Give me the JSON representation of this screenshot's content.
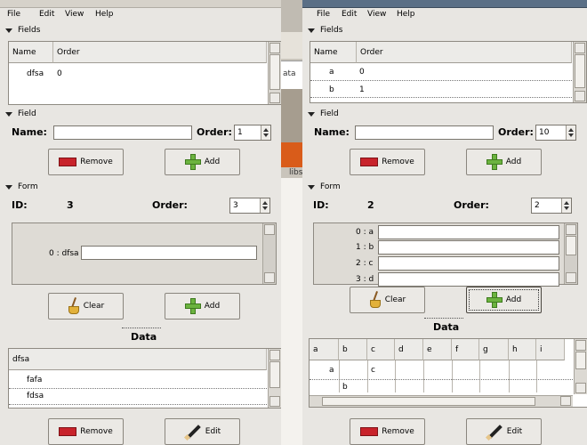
{
  "menu": [
    "File",
    "Edit",
    "View",
    "Help"
  ],
  "section_titles": {
    "fields": "Fields",
    "field": "Field",
    "form": "Form",
    "data": "Data"
  },
  "labels": {
    "name": "Name:",
    "order": "Order:",
    "id": "ID:"
  },
  "buttons": {
    "remove": "Remove",
    "add": "Add",
    "clear": "Clear",
    "edit": "Edit"
  },
  "left": {
    "fields_columns": [
      "Name",
      "Order"
    ],
    "fields_rows": [
      {
        "name": "dfsa",
        "order": "0"
      }
    ],
    "field_name_value": "",
    "field_order_value": "1",
    "form_id": "3",
    "form_order_value": "3",
    "form_entries": [
      {
        "label": "0 : dfsa",
        "value": ""
      }
    ],
    "data_columns": [
      "dfsa"
    ],
    "data_rows": [
      "fafa",
      "fdsa"
    ]
  },
  "right": {
    "fields_columns": [
      "Name",
      "Order"
    ],
    "fields_rows": [
      {
        "name": "a",
        "order": "0"
      },
      {
        "name": "b",
        "order": "1"
      }
    ],
    "field_name_value": "",
    "field_order_value": "10",
    "form_id": "2",
    "form_order_value": "2",
    "form_entries": [
      {
        "label": "0 : a",
        "value": ""
      },
      {
        "label": "1 : b",
        "value": ""
      },
      {
        "label": "2 : c",
        "value": ""
      },
      {
        "label": "3 : d",
        "value": ""
      }
    ],
    "data_columns": [
      "a",
      "b",
      "c",
      "d",
      "e",
      "f",
      "g",
      "h",
      "i"
    ],
    "data_rows": [
      [
        "a",
        "",
        "c",
        "",
        "",
        "",
        "",
        "",
        ""
      ],
      [
        "",
        "b",
        "",
        "",
        "",
        "",
        "",
        "",
        ""
      ]
    ]
  },
  "background_window": {
    "tab_text": "ata",
    "side_text": "libs"
  },
  "colors": {
    "titlebar_active": "#5a6f86",
    "window_bg": "#e8e6e2",
    "remove_icon": "#c8232b",
    "add_icon": "#6cb33f"
  }
}
